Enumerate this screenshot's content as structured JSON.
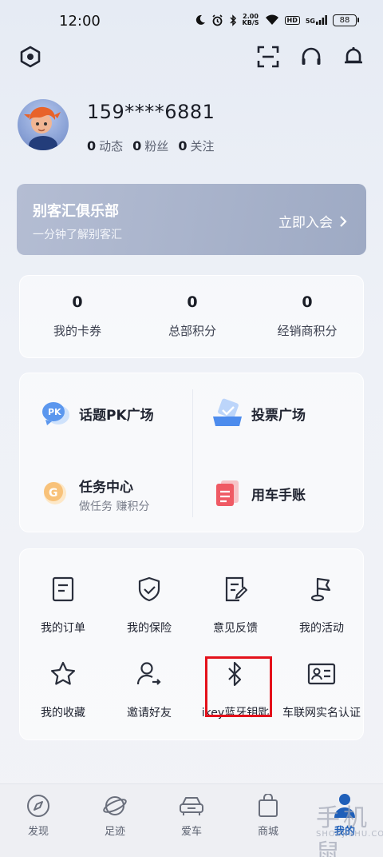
{
  "status_bar": {
    "time": "12:00",
    "net_speed_value": "2.00",
    "net_speed_unit": "KB/S",
    "hd": "HD",
    "signal": "5G",
    "battery": "88"
  },
  "profile": {
    "phone": "159****6881",
    "stats": [
      {
        "value": "0",
        "label": "动态"
      },
      {
        "value": "0",
        "label": "粉丝"
      },
      {
        "value": "0",
        "label": "关注"
      }
    ]
  },
  "club": {
    "title": "别客汇俱乐部",
    "subtitle": "一分钟了解别客汇",
    "join_label": "立即入会"
  },
  "points": [
    {
      "value": "0",
      "label": "我的卡券"
    },
    {
      "value": "0",
      "label": "总部积分"
    },
    {
      "value": "0",
      "label": "经销商积分"
    }
  ],
  "features": [
    {
      "title": "话题PK广场",
      "subtitle": "",
      "icon": "pk-icon"
    },
    {
      "title": "投票广场",
      "subtitle": "",
      "icon": "vote-icon"
    },
    {
      "title": "任务中心",
      "subtitle": "做任务 赚积分",
      "icon": "task-icon"
    },
    {
      "title": "用车手账",
      "subtitle": "",
      "icon": "logbook-icon"
    }
  ],
  "menu": [
    {
      "label": "我的订单",
      "icon": "order-icon"
    },
    {
      "label": "我的保险",
      "icon": "insurance-shield-icon"
    },
    {
      "label": "意见反馈",
      "icon": "feedback-icon"
    },
    {
      "label": "我的活动",
      "icon": "activity-flag-icon"
    },
    {
      "label": "我的收藏",
      "icon": "star-icon"
    },
    {
      "label": "邀请好友",
      "icon": "invite-user-icon"
    },
    {
      "label": "ikey蓝牙钥匙",
      "icon": "bluetooth-icon"
    },
    {
      "label": "车联网实名认证",
      "icon": "id-card-icon"
    }
  ],
  "bottom_nav": [
    {
      "label": "发现",
      "icon": "compass-icon",
      "active": false
    },
    {
      "label": "足迹",
      "icon": "planet-icon",
      "active": false
    },
    {
      "label": "爱车",
      "icon": "car-icon",
      "active": false
    },
    {
      "label": "商城",
      "icon": "shopping-bag-icon",
      "active": false
    },
    {
      "label": "我的",
      "icon": "user-icon",
      "active": true
    }
  ],
  "watermark": {
    "main": "手机鼠",
    "sub": "SHOUJISHU.COM"
  },
  "colors": {
    "accent": "#1f5fb9",
    "highlight": "#e4111b",
    "club_banner": "#a7b2cb"
  }
}
